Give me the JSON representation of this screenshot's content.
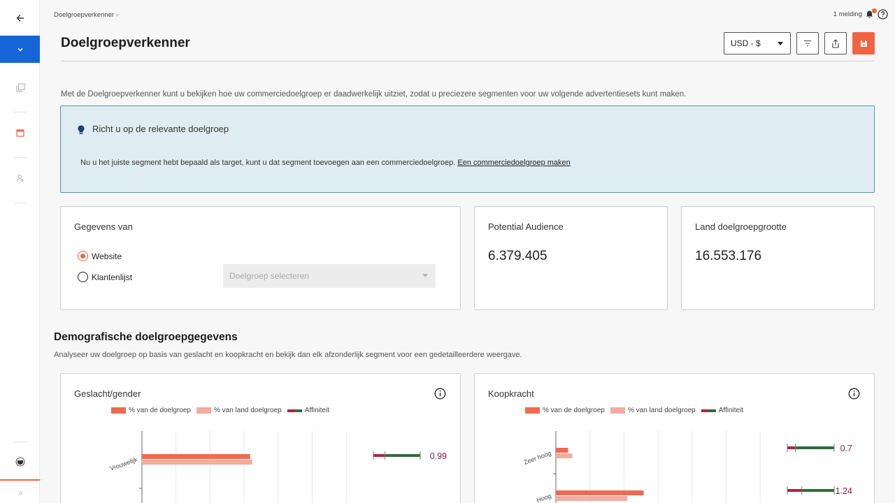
{
  "breadcrumb": {
    "item": "Doelgroepverkenner",
    "separator": "»"
  },
  "notifications": {
    "label": "1 melding"
  },
  "header": {
    "title": "Doelgroepverkenner",
    "currency": "USD - $"
  },
  "intro": "Met de Doelgroepverkenner kunt u bekijken hoe uw commerciedoelgroep er daadwerkelijk uitziet, zodat u preciezere segmenten voor uw volgende advertentiesets kunt maken.",
  "info_box": {
    "title": "Richt u op de relevante doelgroep",
    "text": "Nu u het juiste segment hebt bepaald als target, kunt u dat segment toevoegen aan een commerciedoelgroep.",
    "link": "Een commerciedoelgroep maken"
  },
  "data_source": {
    "title": "Gegevens van",
    "options": [
      "Website",
      "Klantenlijst"
    ],
    "selected": "Website",
    "select_placeholder": "Doelgroep selecteren"
  },
  "potential_audience": {
    "title": "Potential Audience",
    "value": "6.379.405"
  },
  "country_audience": {
    "title": "Land doelgroepgrootte",
    "value": "16.553.176"
  },
  "demographics": {
    "title": "Demografische doelgroepgegevens",
    "subtitle": "Analyseer uw doelgroep op basis van geslacht en koopkracht en bekijk dan elk afzonderlijk segment voor een gedetailleerdere weergave."
  },
  "legend": {
    "audience": "% van de doelgroep",
    "country": "% van land doelgroep",
    "affinity": "Affiniteit"
  },
  "colors": {
    "accent": "#f06444",
    "sidebar_active": "#1565d8",
    "bar_audience": "#ef6a50",
    "bar_country": "#f4aba0",
    "affinity_low": "#b3223f",
    "affinity_high": "#2f6b3a",
    "info_bg": "#dfedf2"
  },
  "chart_data": [
    {
      "type": "bar",
      "title": "Geslacht/gender",
      "orientation": "horizontal",
      "categories": [
        "Vrouwelijk"
      ],
      "series": [
        {
          "name": "% van de doelgroep",
          "values": [
            53
          ]
        },
        {
          "name": "% van land doelgroep",
          "values": [
            54
          ]
        }
      ],
      "xlim": [
        0,
        100
      ],
      "affinity": [
        0.99
      ],
      "affinity_labels": [
        "0.99"
      ],
      "grid": true,
      "legend": "top"
    },
    {
      "type": "bar",
      "title": "Koopkracht",
      "orientation": "horizontal",
      "categories": [
        "Zeer hoog",
        "Hoog"
      ],
      "series": [
        {
          "name": "% van de doelgroep",
          "values": [
            6,
            43
          ]
        },
        {
          "name": "% van land doelgroep",
          "values": [
            8,
            35
          ]
        }
      ],
      "xlim": [
        0,
        100
      ],
      "affinity": [
        0.7,
        1.24
      ],
      "affinity_labels": [
        "0.7",
        "1.24"
      ],
      "grid": true,
      "legend": "top"
    }
  ]
}
